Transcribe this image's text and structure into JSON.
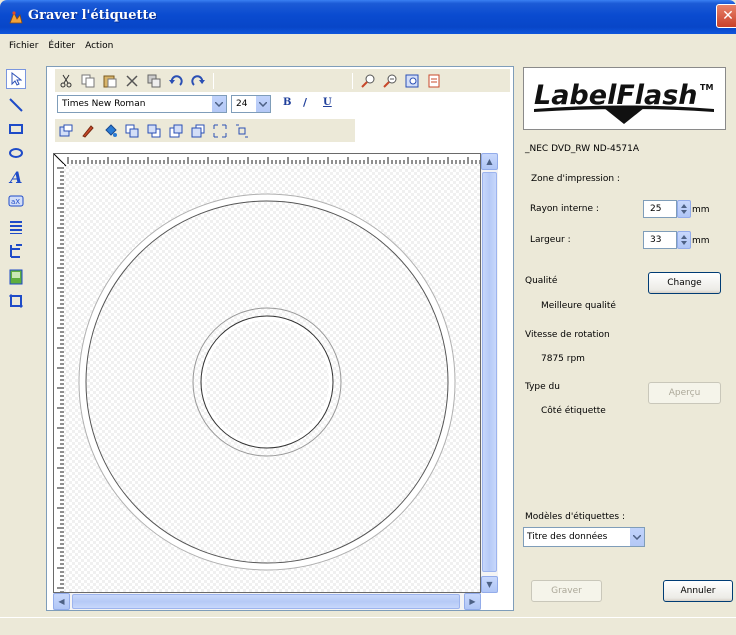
{
  "window": {
    "title": "Graver l'étiquette",
    "close_label": "✕"
  },
  "menu": [
    "Fichier",
    "Éditer",
    "Action"
  ],
  "toolbar": {
    "font": "Times New Roman",
    "size": "24",
    "bold": "B",
    "italic": "/",
    "underline": "U"
  },
  "panel": {
    "logo_text": "LabelFlash",
    "logo_tm": "TM",
    "drive": "_NEC DVD_RW ND-4571A",
    "zone_label": "Zone d'impression :",
    "rayon_label": "Rayon interne :",
    "rayon_value": "25",
    "largeur_label": "Largeur :",
    "largeur_value": "33",
    "unit": "mm",
    "qualite_label": "Qualité",
    "qualite_value": "Meilleure qualité",
    "change_label": "Change",
    "vitesse_label": "Vitesse de rotation",
    "vitesse_value": "7875 rpm",
    "type_label": "Type du",
    "type_value": "Côté étiquette",
    "apercu_label": "Aperçu",
    "modeles_label": "Modèles d'étiquettes :",
    "modeles_value": "Titre des données",
    "graver_label": "Graver",
    "annuler_label": "Annuler"
  },
  "colors": {
    "accent": "#0A4BD0",
    "scroll": "#C1D3FB"
  }
}
